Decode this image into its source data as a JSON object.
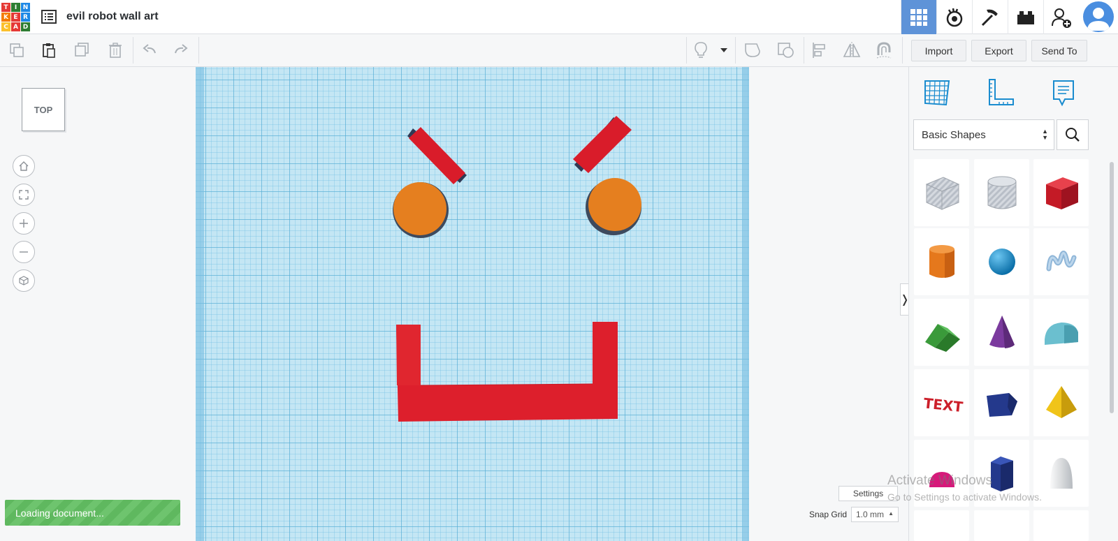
{
  "app": {
    "logo_letters": [
      "T",
      "I",
      "N",
      "K",
      "E",
      "R",
      "C",
      "A",
      "D"
    ],
    "logo_colors": [
      "#e53935",
      "#2e7d32",
      "#1e88e5",
      "#f57c00",
      "#e53935",
      "#1e88e5",
      "#fbc02d",
      "#e53935",
      "#2e7d32"
    ],
    "document_title": "evil robot wall art"
  },
  "header": {
    "buttons": [
      {
        "name": "3d-design-grid-icon",
        "active": true
      },
      {
        "name": "codeblocks-icon",
        "active": false
      },
      {
        "name": "minecraft-pickaxe-icon",
        "active": false
      },
      {
        "name": "lego-brick-icon",
        "active": false
      },
      {
        "name": "invite-user-icon",
        "active": false
      }
    ],
    "accent_color": "#5e93d8"
  },
  "toolbar": {
    "tools": [
      "copy-icon",
      "paste-icon",
      "duplicate-icon",
      "delete-icon",
      "undo-icon",
      "redo-icon"
    ],
    "right_tools": [
      "light-bulb-icon",
      "shape-solid-icon",
      "shape-hole-icon",
      "align-icon",
      "mirror-icon",
      "group-magnet-icon"
    ],
    "import_label": "Import",
    "export_label": "Export",
    "send_to_label": "Send To"
  },
  "viewport": {
    "viewcube_label": "TOP",
    "nav_buttons": [
      "home-view-icon",
      "fit-view-icon",
      "zoom-in-icon",
      "zoom-out-icon",
      "perspective-icon"
    ]
  },
  "shapes_panel": {
    "category": "Basic Shapes",
    "collapse_glyph": "❭",
    "shapes": [
      {
        "name": "box-hole",
        "color": "#c9ced6"
      },
      {
        "name": "cylinder-hole",
        "color": "#c9ced6"
      },
      {
        "name": "box",
        "color": "#d0202c"
      },
      {
        "name": "cylinder",
        "color": "#e5781c"
      },
      {
        "name": "sphere",
        "color": "#1c97d6"
      },
      {
        "name": "scribble",
        "color": "#8fb6d8"
      },
      {
        "name": "roof",
        "color": "#3a9a3a"
      },
      {
        "name": "cone",
        "color": "#7b3a9e"
      },
      {
        "name": "round-roof",
        "color": "#6bbfcf"
      },
      {
        "name": "text",
        "color": "#cc1f2a"
      },
      {
        "name": "wedge-prism",
        "color": "#24398c"
      },
      {
        "name": "pyramid",
        "color": "#f0c419"
      },
      {
        "name": "half-sphere",
        "color": "#d6197a"
      },
      {
        "name": "polygon",
        "color": "#24398c"
      },
      {
        "name": "paraboloid",
        "color": "#e8e8e8"
      }
    ]
  },
  "status": {
    "loading_text": "Loading document...",
    "settings_label": "Settings",
    "snap_grid_label": "Snap Grid",
    "snap_grid_value": "1.0 mm"
  },
  "watermark": {
    "title": "Activate Windows",
    "subtitle": "Go to Settings to activate Windows."
  },
  "scene_colors": {
    "eyebrow": "#d91c2a",
    "eye": "#e57f1f",
    "mouth": "#dd1f2c"
  }
}
